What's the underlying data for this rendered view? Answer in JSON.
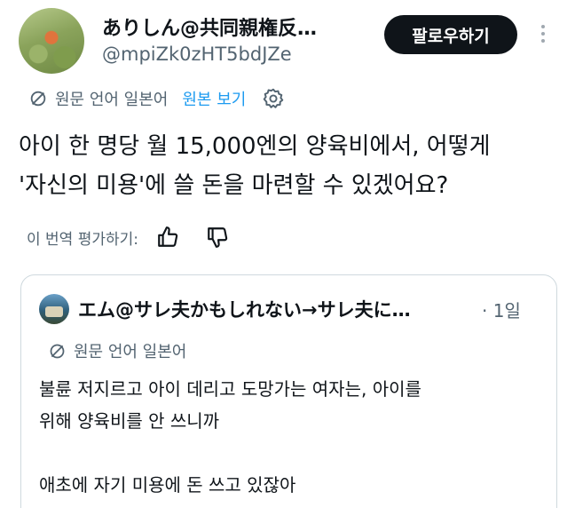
{
  "author": {
    "display_name": "ありしん@共同親権反…",
    "handle": "@mpiZk0zHT5bdJZe",
    "follow_label": "팔로우하기"
  },
  "translation": {
    "source_language": "원문 언어 일본어",
    "show_original": "원본 보기"
  },
  "tweet": {
    "line1": "아이 한 명당 월 15,000엔의 양육비에서, 어떻게",
    "line2": "'자신의 미용'에 쓸 돈을 마련할 수 있겠어요?"
  },
  "rating": {
    "label": "이 번역 평가하기:"
  },
  "quoted": {
    "display_name": "エム@サレ夫かもしれない→サレ夫に…",
    "time": "· 1일",
    "source_language": "원문 언어 일본어",
    "line1": "불륜 저지르고 아이 데리고 도망가는 여자는, 아이를",
    "line2": "위해 양육비를 안 쓰니까",
    "line3": "",
    "line4": "애초에 자기 미용에 돈 쓰고 있잖아"
  },
  "colors": {
    "text": "#0f1419",
    "secondary": "#536471",
    "link": "#1d9bf0",
    "button": "#0f1419",
    "border": "#cfd9de"
  }
}
